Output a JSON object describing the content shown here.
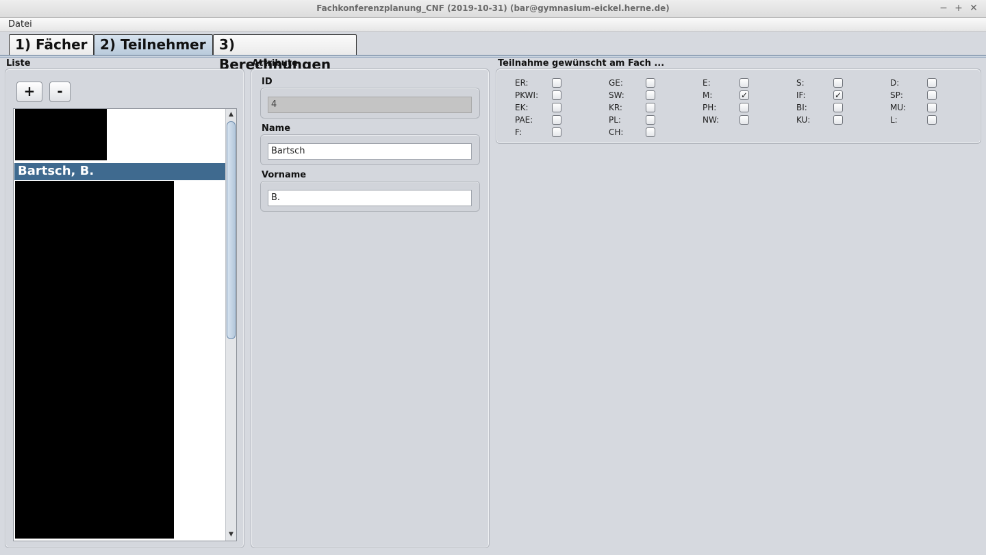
{
  "window": {
    "title": "Fachkonferenzplanung_CNF (2019-10-31) (bar@gymnasium-eickel.herne.de)",
    "minimize_icon": "−",
    "maximize_icon": "+",
    "close_icon": "✕"
  },
  "menubar": {
    "items": [
      "Datei"
    ]
  },
  "tabs": [
    {
      "label": "1) Fächer",
      "active": false
    },
    {
      "label": "2) Teilnehmer",
      "active": true
    },
    {
      "label": "3) Berechnungen",
      "active": false
    }
  ],
  "list_panel": {
    "title": "Liste",
    "add_label": "+",
    "remove_label": "-",
    "selected_item": "Bartsch, B.",
    "scroll_up": "▲",
    "scroll_down": "▼"
  },
  "attributes": {
    "title": "Attribute",
    "id_label": "ID",
    "id_value": "4",
    "name_label": "Name",
    "name_value": "Bartsch",
    "vorname_label": "Vorname",
    "vorname_value": "B."
  },
  "subjects": {
    "title": "Teilnahme gewünscht am Fach ...",
    "check_glyph": "✓",
    "items": [
      {
        "label": "ER:",
        "checked": false
      },
      {
        "label": "GE:",
        "checked": false
      },
      {
        "label": "E:",
        "checked": false
      },
      {
        "label": "S:",
        "checked": false
      },
      {
        "label": "D:",
        "checked": false
      },
      {
        "label": "PKWI:",
        "checked": false
      },
      {
        "label": "SW:",
        "checked": false
      },
      {
        "label": "M:",
        "checked": true
      },
      {
        "label": "IF:",
        "checked": true
      },
      {
        "label": "SP:",
        "checked": false
      },
      {
        "label": "EK:",
        "checked": false
      },
      {
        "label": "KR:",
        "checked": false
      },
      {
        "label": "PH:",
        "checked": false
      },
      {
        "label": "BI:",
        "checked": false
      },
      {
        "label": "MU:",
        "checked": false
      },
      {
        "label": "PAE:",
        "checked": false
      },
      {
        "label": "PL:",
        "checked": false
      },
      {
        "label": "NW:",
        "checked": false
      },
      {
        "label": "KU:",
        "checked": false
      },
      {
        "label": "L:",
        "checked": false
      },
      {
        "label": "F:",
        "checked": false
      },
      {
        "label": "CH:",
        "checked": false
      }
    ]
  }
}
